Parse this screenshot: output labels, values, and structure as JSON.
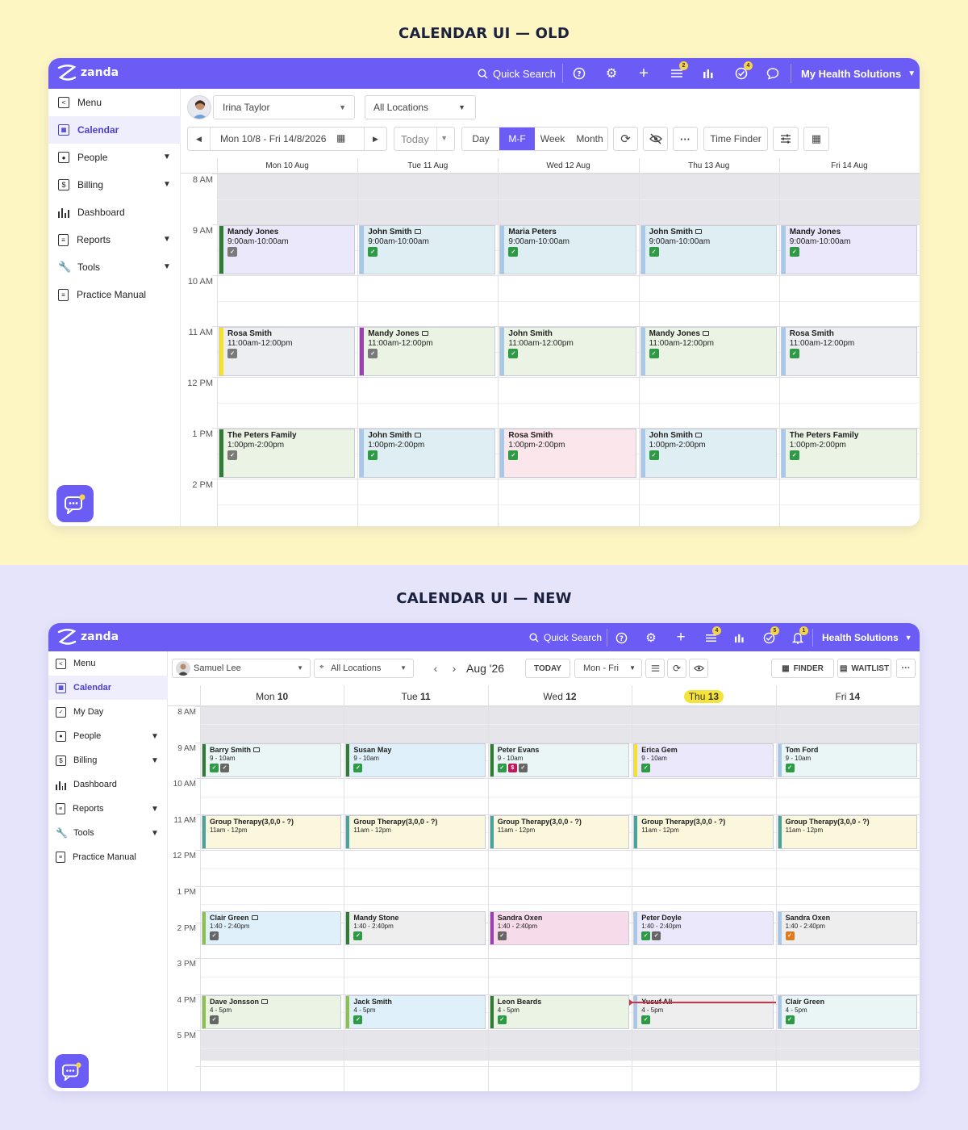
{
  "headings": {
    "old": "CALENDAR UI — OLD",
    "new": "CALENDAR UI — NEW"
  },
  "colors": {
    "brand": "#6a5cf4",
    "badge": "#f5d34a",
    "active_bg": "#eeeefd",
    "old_bg": "#fdf6c3",
    "new_bg": "#e6e4fb",
    "now_line": "#d32f4a"
  },
  "old": {
    "topbar": {
      "logo": "zanda",
      "quick_search": "Quick Search",
      "icons": [
        "help-icon",
        "settings-icon",
        "add-icon",
        "tasks-icon",
        "reports-chart-icon",
        "check-icon",
        "chat-icon"
      ],
      "tasks_badge": "2",
      "check_badge": "4",
      "account": "My Health Solutions"
    },
    "sidebar": [
      "Menu",
      "Calendar",
      "People",
      "Billing",
      "Dashboard",
      "Reports",
      "Tools",
      "Practice Manual"
    ],
    "toolbar": {
      "practitioner": "Irina Taylor",
      "location": "All Locations",
      "date_range": "Mon 10/8 - Fri 14/8/2026",
      "today": "Today",
      "views": [
        "Day",
        "M-F",
        "Week",
        "Month"
      ],
      "active_view": "M-F",
      "time_finder": "Time Finder"
    },
    "days": [
      "Mon 10 Aug",
      "Tue 11 Aug",
      "Wed 12 Aug",
      "Thu 13 Aug",
      "Fri 14 Aug"
    ],
    "times": [
      "8 AM",
      "9 AM",
      "10 AM",
      "11 AM",
      "12 PM",
      "1 PM",
      "2 PM"
    ],
    "appointments": [
      {
        "day": 0,
        "start": 9,
        "end": 10,
        "name": "Mandy Jones",
        "time": "9:00am-10:00am",
        "video": false,
        "bg": "#ebe8fb",
        "bar": "#2e7d32",
        "icons": [
          "#7a7a7a"
        ]
      },
      {
        "day": 1,
        "start": 9,
        "end": 10,
        "name": "John Smith",
        "time": "9:00am-10:00am",
        "video": true,
        "bg": "#deeef2",
        "bar": "#a7c8e8",
        "icons": [
          "#2f9a46"
        ]
      },
      {
        "day": 2,
        "start": 9,
        "end": 10,
        "name": "Maria Peters",
        "time": "9:00am-10:00am",
        "video": false,
        "bg": "#deeef2",
        "bar": "#a7c8e8",
        "icons": [
          "#2f9a46"
        ]
      },
      {
        "day": 3,
        "start": 9,
        "end": 10,
        "name": "John Smith",
        "time": "9:00am-10:00am",
        "video": true,
        "bg": "#deeef2",
        "bar": "#a7c8e8",
        "icons": [
          "#2f9a46"
        ]
      },
      {
        "day": 4,
        "start": 9,
        "end": 10,
        "name": "Mandy Jones",
        "time": "9:00am-10:00am",
        "video": false,
        "bg": "#ebe8fb",
        "bar": "#a7c8e8",
        "icons": [
          "#2f9a46"
        ]
      },
      {
        "day": 0,
        "start": 11,
        "end": 12,
        "name": "Rosa Smith",
        "time": "11:00am-12:00pm",
        "video": false,
        "bg": "#eceef1",
        "bar": "#f5e12a",
        "icons": [
          "#7a7a7a"
        ]
      },
      {
        "day": 1,
        "start": 11,
        "end": 12,
        "name": "Mandy Jones",
        "time": "11:00am-12:00pm",
        "video": true,
        "bg": "#eaf3e4",
        "bar": "#9c3fb0",
        "icons": [
          "#7a7a7a"
        ]
      },
      {
        "day": 2,
        "start": 11,
        "end": 12,
        "name": "John Smith",
        "time": "11:00am-12:00pm",
        "video": false,
        "bg": "#eaf3e4",
        "bar": "#a7c8e8",
        "icons": [
          "#2f9a46"
        ]
      },
      {
        "day": 3,
        "start": 11,
        "end": 12,
        "name": "Mandy Jones",
        "time": "11:00am-12:00pm",
        "video": true,
        "bg": "#eaf3e4",
        "bar": "#a7c8e8",
        "icons": [
          "#2f9a46"
        ]
      },
      {
        "day": 4,
        "start": 11,
        "end": 12,
        "name": "Rosa Smith",
        "time": "11:00am-12:00pm",
        "video": false,
        "bg": "#eceef1",
        "bar": "#a7c8e8",
        "icons": [
          "#2f9a46"
        ]
      },
      {
        "day": 0,
        "start": 13,
        "end": 14,
        "name": "The Peters Family",
        "time": "1:00pm-2:00pm",
        "video": false,
        "bg": "#eaf3e4",
        "bar": "#2e7d32",
        "icons": [
          "#7a7a7a"
        ]
      },
      {
        "day": 1,
        "start": 13,
        "end": 14,
        "name": "John Smith",
        "time": "1:00pm-2:00pm",
        "video": true,
        "bg": "#deeef2",
        "bar": "#a7c8e8",
        "icons": [
          "#2f9a46"
        ]
      },
      {
        "day": 2,
        "start": 13,
        "end": 14,
        "name": "Rosa Smith",
        "time": "1:00pm-2:00pm",
        "video": false,
        "bg": "#fbe6ec",
        "bar": "#a7c8e8",
        "icons": [
          "#2f9a46"
        ]
      },
      {
        "day": 3,
        "start": 13,
        "end": 14,
        "name": "John Smith",
        "time": "1:00pm-2:00pm",
        "video": true,
        "bg": "#deeef2",
        "bar": "#a7c8e8",
        "icons": [
          "#2f9a46"
        ]
      },
      {
        "day": 4,
        "start": 13,
        "end": 14,
        "name": "The Peters Family",
        "time": "1:00pm-2:00pm",
        "video": false,
        "bg": "#eaf3e4",
        "bar": "#a7c8e8",
        "icons": [
          "#2f9a46"
        ]
      }
    ]
  },
  "new": {
    "topbar": {
      "logo": "zanda",
      "quick_search": "Quick Search",
      "icons": [
        "help-icon",
        "settings-icon",
        "add-icon",
        "tasks-icon",
        "reports-chart-icon",
        "check-icon",
        "notifications-icon"
      ],
      "tasks_badge": "4",
      "check_badge": "5",
      "bell_badge": "1",
      "account": "Health Solutions"
    },
    "sidebar": [
      "Menu",
      "Calendar",
      "My Day",
      "People",
      "Billing",
      "Dashboard",
      "Reports",
      "Tools",
      "Practice Manual"
    ],
    "toolbar": {
      "practitioner": "Samuel Lee",
      "location": "All Locations",
      "month": "Aug '26",
      "today": "TODAY",
      "view": "Mon - Fri",
      "finder": "FINDER",
      "waitlist": "WAITLIST"
    },
    "days": [
      {
        "dow": "Mon",
        "num": "10",
        "today": false
      },
      {
        "dow": "Tue",
        "num": "11",
        "today": false
      },
      {
        "dow": "Wed",
        "num": "12",
        "today": false
      },
      {
        "dow": "Thu",
        "num": "13",
        "today": true
      },
      {
        "dow": "Fri",
        "num": "14",
        "today": false
      }
    ],
    "times": [
      "8 AM",
      "9 AM",
      "10 AM",
      "11 AM",
      "12 PM",
      "1 PM",
      "2 PM",
      "3 PM",
      "4 PM",
      "5 PM"
    ],
    "now_time": 16.2,
    "appointments": [
      {
        "day": 0,
        "start": 9,
        "end": 10,
        "name": "Barry Smith",
        "time": "9 - 10am",
        "video": true,
        "bg": "#eaf6f6",
        "bar": "#2e7d32",
        "icons": [
          "#2f9a46",
          "#666666"
        ]
      },
      {
        "day": 1,
        "start": 9,
        "end": 10,
        "name": "Susan May",
        "time": "9 - 10am",
        "video": false,
        "bg": "#dff0fa",
        "bar": "#2e7d32",
        "icons": [
          "#2f9a46"
        ]
      },
      {
        "day": 2,
        "start": 9,
        "end": 10,
        "name": "Peter Evans",
        "time": "9 - 10am",
        "video": false,
        "bg": "#eaf6f6",
        "bar": "#2e7d32",
        "icons": [
          "#2f9a46",
          "#c2185b",
          "#666666"
        ]
      },
      {
        "day": 3,
        "start": 9,
        "end": 10,
        "name": "Erica Gem",
        "time": "9 - 10am",
        "video": false,
        "bg": "#ebe8fb",
        "bar": "#f5e12a",
        "icons": [
          "#2f9a46"
        ]
      },
      {
        "day": 4,
        "start": 9,
        "end": 10,
        "name": "Tom Ford",
        "time": "9 - 10am",
        "video": false,
        "bg": "#eaf6f6",
        "bar": "#a7c8e8",
        "icons": [
          "#2f9a46"
        ]
      },
      {
        "day": 0,
        "start": 11,
        "end": 12,
        "name": "Group Therapy(3,0,0 - ?)",
        "time": "11am - 12pm",
        "video": false,
        "bg": "#fbf7dc",
        "bar": "#4aa39a",
        "icons": []
      },
      {
        "day": 1,
        "start": 11,
        "end": 12,
        "name": "Group Therapy(3,0,0 - ?)",
        "time": "11am - 12pm",
        "video": false,
        "bg": "#fbf7dc",
        "bar": "#4aa39a",
        "icons": []
      },
      {
        "day": 2,
        "start": 11,
        "end": 12,
        "name": "Group Therapy(3,0,0 - ?)",
        "time": "11am - 12pm",
        "video": false,
        "bg": "#fbf7dc",
        "bar": "#4aa39a",
        "icons": []
      },
      {
        "day": 3,
        "start": 11,
        "end": 12,
        "name": "Group Therapy(3,0,0 - ?)",
        "time": "11am - 12pm",
        "video": false,
        "bg": "#fbf7dc",
        "bar": "#4aa39a",
        "icons": []
      },
      {
        "day": 4,
        "start": 11,
        "end": 12,
        "name": "Group Therapy(3,0,0 - ?)",
        "time": "11am - 12pm",
        "video": false,
        "bg": "#fbf7dc",
        "bar": "#4aa39a",
        "icons": []
      },
      {
        "day": 0,
        "start": 13.667,
        "end": 14.667,
        "name": "Clair Green",
        "time": "1:40 - 2:40pm",
        "video": true,
        "bg": "#dff0fa",
        "bar": "#8bc34a",
        "icons": [
          "#666666"
        ]
      },
      {
        "day": 1,
        "start": 13.667,
        "end": 14.667,
        "name": "Mandy Stone",
        "time": "1:40 - 2:40pm",
        "video": false,
        "bg": "#eeeeef",
        "bar": "#2e7d32",
        "icons": [
          "#2f9a46"
        ]
      },
      {
        "day": 2,
        "start": 13.667,
        "end": 14.667,
        "name": "Sandra Oxen",
        "time": "1:40 - 2:40pm",
        "video": false,
        "bg": "#f6dcea",
        "bar": "#9c3fb0",
        "icons": [
          "#666666"
        ]
      },
      {
        "day": 3,
        "start": 13.667,
        "end": 14.667,
        "name": "Peter Doyle",
        "time": "1:40 - 2:40pm",
        "video": false,
        "bg": "#ebe8fb",
        "bar": "#a7c8e8",
        "icons": [
          "#2f9a46",
          "#666666"
        ]
      },
      {
        "day": 4,
        "start": 13.667,
        "end": 14.667,
        "name": "Sandra Oxen",
        "time": "1:40 - 2:40pm",
        "video": false,
        "bg": "#eeeeef",
        "bar": "#a7c8e8",
        "icons": [
          "#e07a1f"
        ]
      },
      {
        "day": 0,
        "start": 16,
        "end": 17,
        "name": "Dave Jonsson",
        "time": "4 - 5pm",
        "video": true,
        "bg": "#eaf3e4",
        "bar": "#8bc34a",
        "icons": [
          "#666666"
        ]
      },
      {
        "day": 1,
        "start": 16,
        "end": 17,
        "name": "Jack Smith",
        "time": "4 - 5pm",
        "video": false,
        "bg": "#dff0fa",
        "bar": "#8bc34a",
        "icons": [
          "#2f9a46"
        ]
      },
      {
        "day": 2,
        "start": 16,
        "end": 17,
        "name": "Leon Beards",
        "time": "4 - 5pm",
        "video": false,
        "bg": "#eaf3e4",
        "bar": "#2e7d32",
        "icons": [
          "#2f9a46"
        ]
      },
      {
        "day": 3,
        "start": 16,
        "end": 17,
        "name": "Yusuf Ali",
        "time": "4 - 5pm",
        "video": false,
        "bg": "#eeeeef",
        "bar": "#a7c8e8",
        "icons": [
          "#2f9a46"
        ]
      },
      {
        "day": 4,
        "start": 16,
        "end": 17,
        "name": "Clair Green",
        "time": "4 - 5pm",
        "video": false,
        "bg": "#eaf6f6",
        "bar": "#a7c8e8",
        "icons": [
          "#2f9a46"
        ]
      }
    ]
  }
}
